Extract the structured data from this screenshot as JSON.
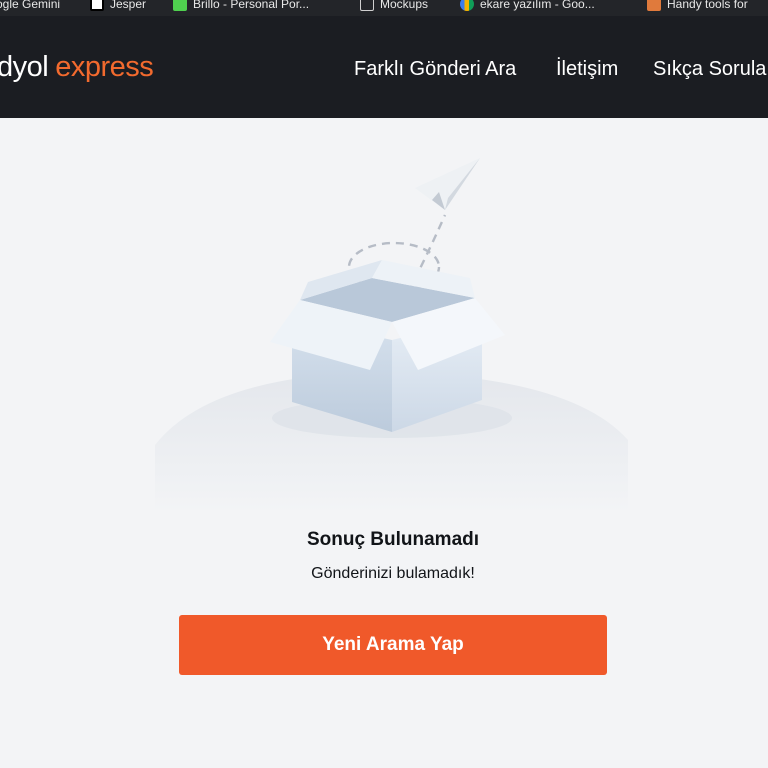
{
  "bookmarks": [
    {
      "label": "ogle Gemini",
      "icon": "gemini-icon"
    },
    {
      "label": "Jesper",
      "icon": "bookmark-icon"
    },
    {
      "label": "Brillo - Personal Por...",
      "icon": "brillo-icon"
    },
    {
      "label": "Mockups",
      "icon": "folder-icon"
    },
    {
      "label": "ekare yazılım - Goo...",
      "icon": "google-drive-icon"
    },
    {
      "label": "Handy tools for",
      "icon": "tools-icon"
    }
  ],
  "header": {
    "logo_part1": "dyol",
    "logo_part2": "express",
    "nav": [
      "Farklı Gönderi Ara",
      "İletişim",
      "Sıkça Sorula"
    ]
  },
  "empty_state": {
    "illustration": "open-box-paper-plane-illustration",
    "title": "Sonuç Bulunamadı",
    "message": "Gönderinizi bulamadık!",
    "button_label": "Yeni Arama Yap"
  },
  "colors": {
    "accent": "#f0592a",
    "header_bg": "#1b1d22",
    "page_bg": "#f3f4f6"
  }
}
